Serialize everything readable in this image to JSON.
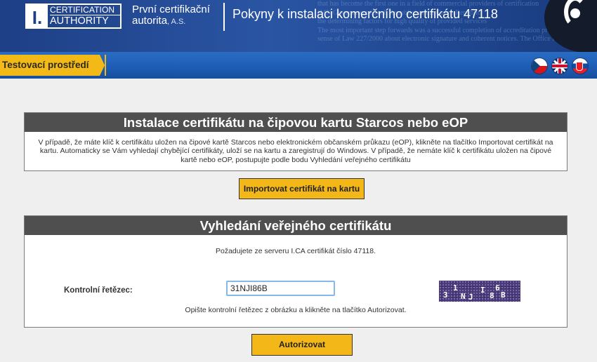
{
  "header": {
    "logo": {
      "mark": "I.",
      "line1": "CERTIFICATION",
      "line2": "AUTHORITY"
    },
    "company_line1": "První certifikační",
    "company_line2": "autorita",
    "company_suffix": ", A.S.",
    "page_title": "Pokyny k instalaci komerčního certifikátu 47118",
    "background_text": [
      "that has become the first one in a field of commercial providers of certification",
      "(MN Government Czech Republic) in the Czech Republic",
      "the determining factors for high quality of provided services",
      "The most important step forwards was a successful completion of accreditation process in",
      "sense of Law 227/2000 about electronic signature and coherent notices. The Office for"
    ]
  },
  "env": {
    "label": "Testovací prostředí",
    "languages": [
      {
        "name": "czech-flag-icon",
        "code": "cz"
      },
      {
        "name": "english-flag-icon",
        "code": "en"
      },
      {
        "name": "slovak-flag-icon",
        "code": "sk"
      }
    ]
  },
  "install_panel": {
    "title": "Instalace certifikátu na čipovou kartu Starcos nebo eOP",
    "description": "V případě, že máte klíč k certifikátu uložen na čipové kartě Starcos nebo elektronickém občanském průkazu (eOP), klikněte na tlačítko Importovat certifikát na kartu. Automaticky se Vám vyhledají chybějící certifikáty, uloží se na kartu a zaregistrují do Windows. V případě, že nemáte klíč k certifikátu uložen na čipové kartě nebo eOP, postupujte podle bodu Vyhledání veřejného certifikátu",
    "import_button": "Importovat certifikát na kartu"
  },
  "search_panel": {
    "title": "Vyhledání veřejného certifikátu",
    "request_text": "Požadujete ze serveru I.CA certifikát číslo 47118.",
    "control_label": "Kontrolní řetězec:",
    "control_value": "31NJI86B",
    "captcha_chars": [
      "3",
      "1",
      "N",
      "J",
      "I",
      "8",
      "6",
      "B"
    ],
    "hint": "Opište kontrolní řetězec z obrázku a klikněte na tlačítko Autorizovat.",
    "authorize_button": "Autorizovat"
  },
  "colors": {
    "header_blue": "#1e3f86",
    "env_bar_blue": "#1f5fb8",
    "accent_yellow": "#f4b718",
    "panel_title_gray": "#4f4f4f"
  }
}
